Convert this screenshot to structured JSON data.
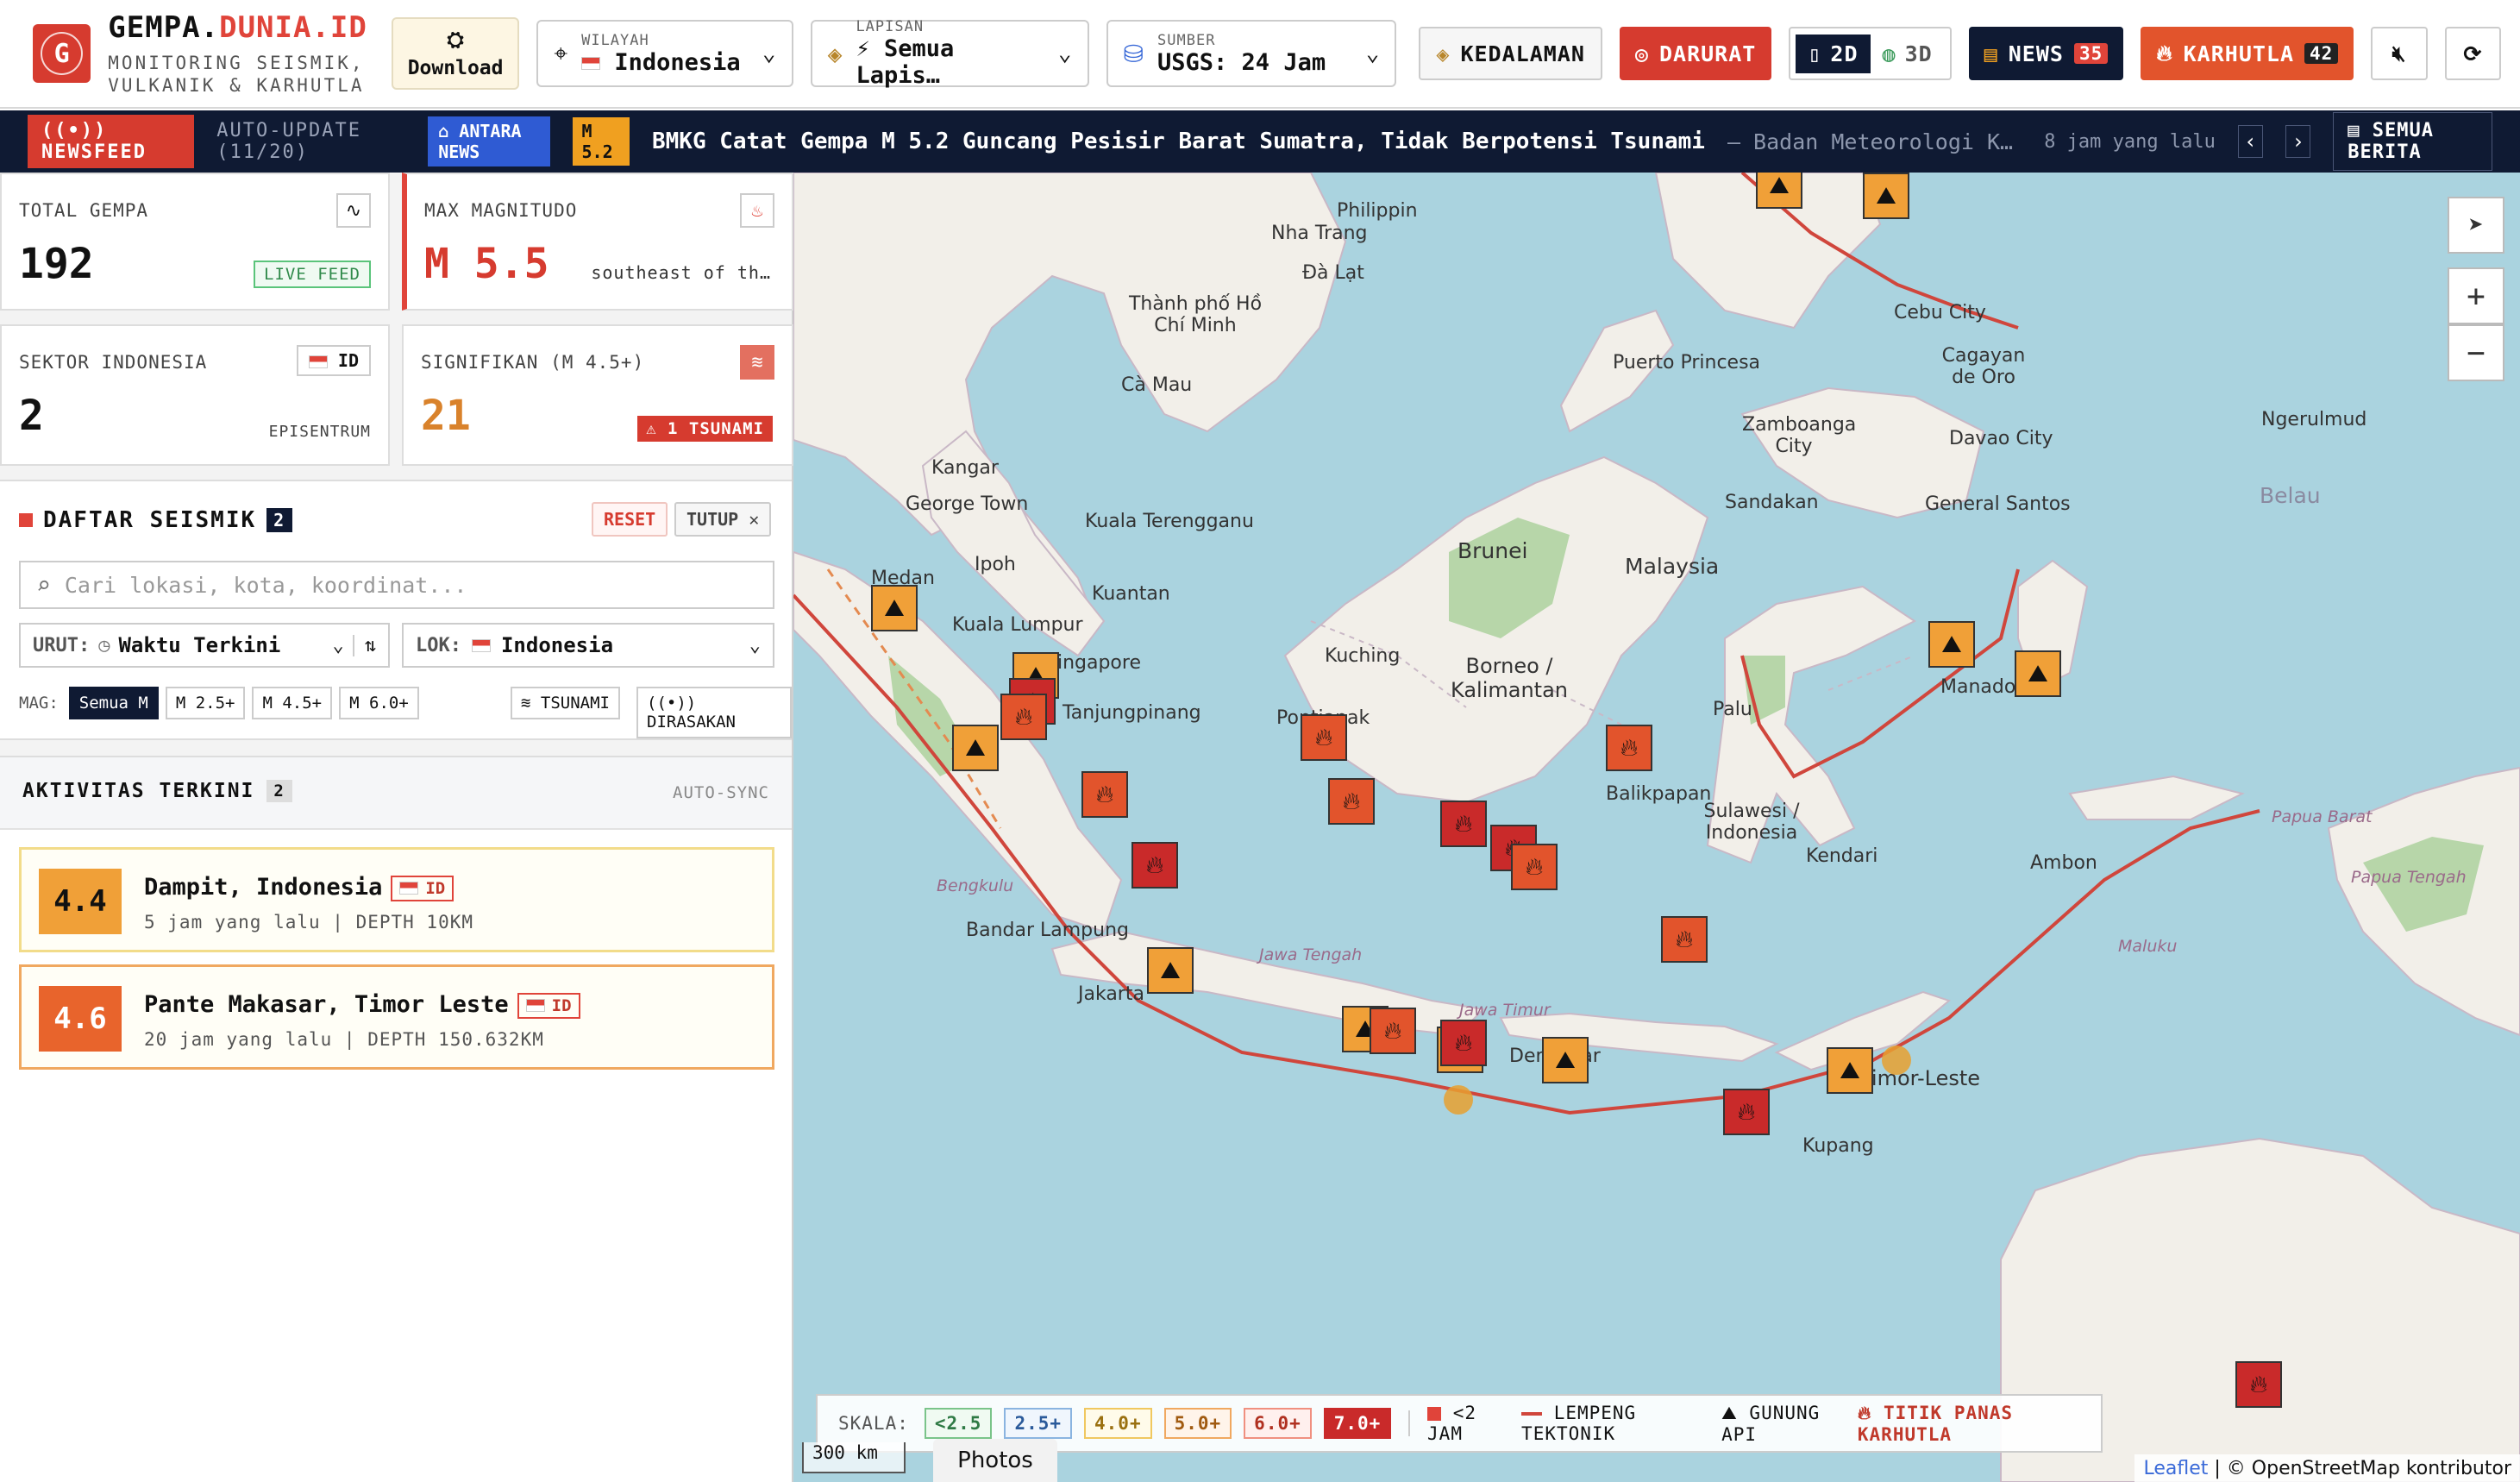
{
  "brand": {
    "title_a": "GEMPA.",
    "title_b": "DUNIA.ID",
    "subtitle_1": "MONITORING SEISMIK,",
    "subtitle_2": "VULKANIK & KARHUTLA"
  },
  "download_label": "Download",
  "wilayah": {
    "label": "WILAYAH",
    "value": "Indonesia"
  },
  "lapisan": {
    "label": "LAPISAN",
    "value": "⚡ Semua Lapis…"
  },
  "sumber": {
    "label": "SUMBER",
    "value": "USGS: 24 Jam"
  },
  "buttons": {
    "kedalaman": "KEDALAMAN",
    "darurat": "DARURAT",
    "view2d": "2D",
    "view3d": "3D",
    "news": "NEWS",
    "news_count": "35",
    "karhutla": "KARHUTLA",
    "karhutla_count": "42"
  },
  "ticker": {
    "newsfeed": "NEWSFEED",
    "auto_update": "AUTO-UPDATE (11/20)",
    "source_tag": "ANTARA NEWS",
    "mag_tag": "M 5.2",
    "headline": "BMKG Catat Gempa M 5.2 Guncang Pesisir Barat Sumatra, Tidak Berpotensi Tsunami",
    "source_text": "— Badan Meteorologi Klimatolo…",
    "time": "8 jam yang lalu",
    "all_news": "SEMUA BERITA"
  },
  "stats": {
    "total": {
      "label": "TOTAL GEMPA",
      "value": "192",
      "tag": "LIVE FEED"
    },
    "max": {
      "label": "MAX MAGNITUDO",
      "value": "M 5.5",
      "sub": "southeast of th…"
    },
    "sektor": {
      "label": "SEKTOR INDONESIA",
      "value": "2",
      "tag": "ID",
      "sub": "EPISENTRUM"
    },
    "signifikan": {
      "label": "SIGNIFIKAN (M 4.5+)",
      "value": "21",
      "tag": "1 TSUNAMI"
    }
  },
  "seismic_list": {
    "title": "DAFTAR SEISMIK",
    "count": "2",
    "reset": "RESET",
    "close": "TUTUP",
    "search_placeholder": "Cari lokasi, kota, koordinat...",
    "sort_label": "URUT:",
    "sort_value": "Waktu Terkini",
    "loc_label": "LOK:",
    "loc_value": "Indonesia",
    "mag_label": "MAG:",
    "mag_filters": [
      "Semua M",
      "M 2.5+",
      "M 4.5+",
      "M 6.0+"
    ],
    "tsunami": "TSUNAMI",
    "felt": "DIRASAKAN"
  },
  "activity": {
    "title": "AKTIVITAS TERKINI",
    "count": "2",
    "sync": "AUTO-SYNC",
    "items": [
      {
        "mag": "4.4",
        "place": "Dampit, Indonesia",
        "tag": "ID",
        "meta": "5 jam yang lalu | DEPTH 10KM"
      },
      {
        "mag": "4.6",
        "place": "Pante Makasar, Timor Leste",
        "tag": "ID",
        "meta": "20 jam yang lalu | DEPTH 150.632KM"
      }
    ]
  },
  "legend": {
    "label": "SKALA:",
    "scales": [
      "<2.5",
      "2.5+",
      "4.0+",
      "5.0+",
      "6.0+",
      "7.0+"
    ],
    "recent": "<2 JAM",
    "plate": "LEMPENG TEKTONIK",
    "volcano": "GUNUNG API",
    "hotspot": "TITIK PANAS KARHUTLA"
  },
  "map": {
    "scale": "300 km",
    "photos": "Photos",
    "attribution_leaflet": "Leaflet",
    "attribution_osm": "| © OpenStreetMap kontributor",
    "labels": {
      "philippines": "Philippin",
      "nha_trang": "Nha Trang",
      "da_lat": "Đà Lạt",
      "hcm": "Thành phố Hồ Chí Minh",
      "ca_mau": "Cà Mau",
      "puerto": "Puerto Princesa",
      "cebu": "Cebu City",
      "cagayan": "Cagayan de Oro",
      "zamboanga": "Zamboanga City",
      "davao": "Davao City",
      "ngerulmud": "Ngerulmud",
      "belau": "Belau",
      "kangar": "Kangar",
      "georgetown": "George Town",
      "kualaterengganu": "Kuala Terengganu",
      "ipoh": "Ipoh",
      "kualalumpur": "Kuala Lumpur",
      "kuantan": "Kuantan",
      "singapore": "Singapore",
      "tanjungpinang": "Tanjungpinang",
      "medan": "Medan",
      "sandakan": "Sandakan",
      "generalsantos": "General Santos",
      "brunei": "Brunei",
      "malaysia": "Malaysia",
      "kuching": "Kuching",
      "borneo": "Borneo / Kalimantan",
      "pontianak": "Pontianak",
      "balikpapan": "Balikpapan",
      "manado": "Manado",
      "palu": "Palu",
      "sulawesi": "Sulawesi / Indonesia",
      "kendari": "Kendari",
      "ambon": "Ambon",
      "bandarlampung": "Bandar Lampung",
      "jakarta": "Jakarta",
      "denpasar": "Denpasar",
      "kupang": "Kupang",
      "timorleste": "Timor-Leste",
      "bengkulu": "Bengkulu",
      "jawatimur": "Jawa Timur",
      "jawatengah": "Jawa Tengah",
      "papuabarat": "Papua Barat",
      "papuatengah": "Papua Tengah",
      "maluku": "Maluku"
    }
  },
  "colors": {
    "accent": "#e0443a",
    "navy": "#0f1a33",
    "ocean": "#aad3df",
    "land": "#f2efe9",
    "forest": "#add19e",
    "plate": "#d0463c"
  }
}
